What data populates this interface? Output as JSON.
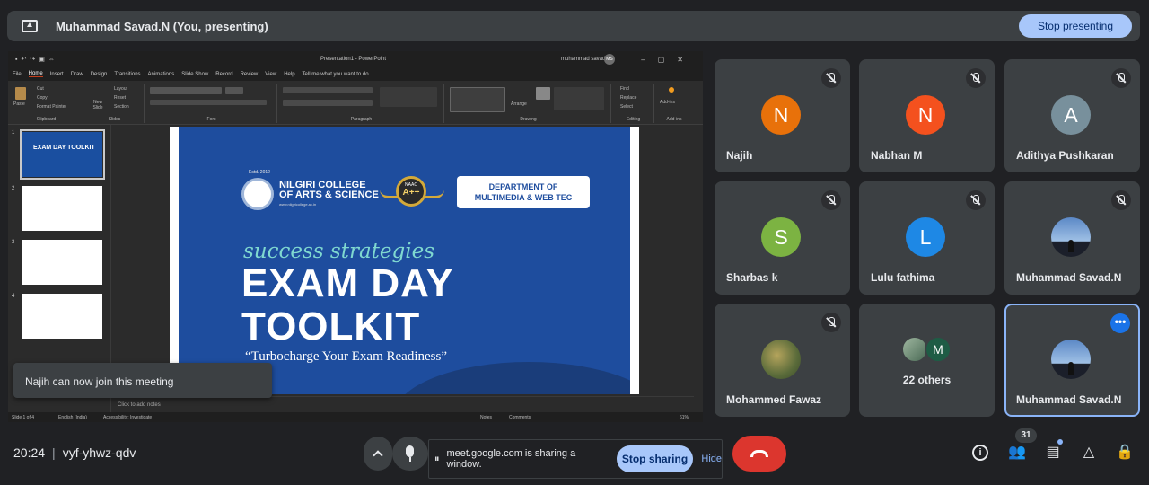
{
  "topbar": {
    "presenter_label": "Muhammad Savad.N (You, presenting)",
    "stop_presenting_label": "Stop presenting"
  },
  "ppt": {
    "doc_title": "Presentation1  -  PowerPoint",
    "user_name": "muhammad savad",
    "user_initials": "MS",
    "tabs": [
      "File",
      "Home",
      "Insert",
      "Draw",
      "Design",
      "Transitions",
      "Animations",
      "Slide Show",
      "Record",
      "Review",
      "View",
      "Help",
      "Tell me what you want to do"
    ],
    "ribbon_groups": [
      "Clipboard",
      "Slides",
      "Font",
      "Paragraph",
      "Drawing",
      "Editing",
      "Add-ins"
    ],
    "clipboard_items": [
      "Cut",
      "Copy",
      "Format Painter"
    ],
    "paste_label": "Paste",
    "slides_items": [
      "New Slide",
      "Layout",
      "Reset",
      "Section"
    ],
    "editing_items": [
      "Find",
      "Replace",
      "Select"
    ],
    "arrange_label": "Arrange",
    "addins_label": "Add-ins",
    "slide_numbers": [
      "1",
      "2",
      "3",
      "4"
    ],
    "thumb_title": "EXAM DAY TOOLKIT",
    "notes_placeholder": "Click to add notes",
    "status_slide": "Slide 1 of 4",
    "status_lang": "English (India)",
    "status_access": "Accessibility: Investigate",
    "status_notes": "Notes",
    "status_comments": "Comments",
    "status_zoom": "61%"
  },
  "slide": {
    "estd": "Estd. 2012",
    "college_line1": "NILGIRI COLLEGE",
    "college_line2": "OF ARTS & SCIENCE",
    "college_url": "www.nilgiricollege.ac.in",
    "naac_top": "NAAC",
    "naac_grade": "A++",
    "dept_line1": "DEPARTMENT OF",
    "dept_line2": "MULTIMEDIA & WEB TEC",
    "tagline": "success strategies",
    "title_line1": "EXAM DAY",
    "title_line2": "TOOLKIT",
    "quote": "“Turbocharge Your Exam Readiness”"
  },
  "toast": {
    "message": "Najih can now join this meeting"
  },
  "participants": [
    {
      "name": "Najih",
      "initial": "N",
      "color": "#e8710a"
    },
    {
      "name": "Nabhan M",
      "initial": "N",
      "color": "#f4511e"
    },
    {
      "name": "Adithya Pushkaran",
      "initial": "A",
      "color": "#78909c"
    },
    {
      "name": "Sharbas k",
      "initial": "S",
      "color": "#7cb342"
    },
    {
      "name": "Lulu fathima",
      "initial": "L",
      "color": "#1e88e5"
    },
    {
      "name": "Muhammad Savad.N",
      "initial": "",
      "color": ""
    },
    {
      "name": "Mohammed Fawaz",
      "initial": "",
      "color": ""
    },
    {
      "name": "",
      "initial": "",
      "color": ""
    },
    {
      "name": "Muhammad Savad.N",
      "initial": "",
      "color": ""
    }
  ],
  "others": {
    "label": "22 others",
    "second_initial": "M"
  },
  "bottombar": {
    "time": "20:24",
    "meeting_code": "vyf-yhwz-qdv",
    "sharing_message": "meet.google.com is sharing a window.",
    "stop_sharing_label": "Stop sharing",
    "hide_label": "Hide",
    "people_count": "31"
  },
  "icons": {
    "present": "present-to-all-icon",
    "mic": "mic-icon",
    "leave": "call-end-icon",
    "info": "info-icon",
    "people": "people-icon",
    "chat": "chat-icon",
    "activities": "activities-icon",
    "host_controls": "host-controls-icon"
  }
}
